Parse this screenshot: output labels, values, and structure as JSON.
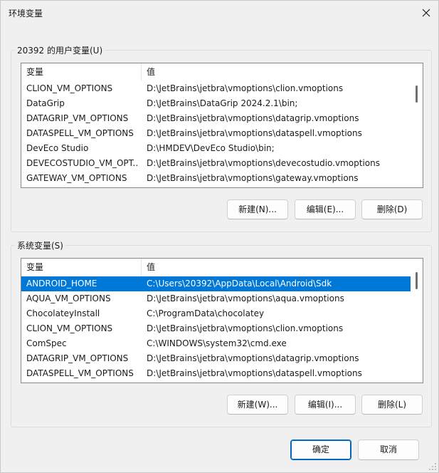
{
  "window": {
    "title": "环境变量",
    "close_icon": "close-icon"
  },
  "user_vars": {
    "group_label": "20392 的用户变量(U)",
    "columns": [
      "变量",
      "值"
    ],
    "rows": [
      {
        "name": "CLION_VM_OPTIONS",
        "value": "D:\\JetBrains\\jetbra\\vmoptions\\clion.vmoptions"
      },
      {
        "name": "DataGrip",
        "value": "D:\\JetBrains\\DataGrip 2024.2.1\\bin;"
      },
      {
        "name": "DATAGRIP_VM_OPTIONS",
        "value": "D:\\JetBrains\\jetbra\\vmoptions\\datagrip.vmoptions"
      },
      {
        "name": "DATASPELL_VM_OPTIONS",
        "value": "D:\\JetBrains\\jetbra\\vmoptions\\dataspell.vmoptions"
      },
      {
        "name": "DevEco Studio",
        "value": "D:\\HMDEV\\DevEco Studio\\bin;"
      },
      {
        "name": "DEVECOSTUDIO_VM_OPT...",
        "value": "D:\\JetBrains\\jetbra\\vmoptions\\devecostudio.vmoptions"
      },
      {
        "name": "GATEWAY_VM_OPTIONS",
        "value": "D:\\JetBrains\\jetbra\\vmoptions\\gateway.vmoptions"
      }
    ],
    "buttons": {
      "new": "新建(N)...",
      "edit": "编辑(E)...",
      "delete": "删除(D)"
    }
  },
  "system_vars": {
    "group_label": "系统变量(S)",
    "columns": [
      "变量",
      "值"
    ],
    "selected_index": 0,
    "rows": [
      {
        "name": "ANDROID_HOME",
        "value": "C:\\Users\\20392\\AppData\\Local\\Android\\Sdk"
      },
      {
        "name": "AQUA_VM_OPTIONS",
        "value": "D:\\JetBrains\\jetbra\\vmoptions\\aqua.vmoptions"
      },
      {
        "name": "ChocolateyInstall",
        "value": "C:\\ProgramData\\chocolatey"
      },
      {
        "name": "CLION_VM_OPTIONS",
        "value": "D:\\JetBrains\\jetbra\\vmoptions\\clion.vmoptions"
      },
      {
        "name": "ComSpec",
        "value": "C:\\WINDOWS\\system32\\cmd.exe"
      },
      {
        "name": "DATAGRIP_VM_OPTIONS",
        "value": "D:\\JetBrains\\jetbra\\vmoptions\\datagrip.vmoptions"
      },
      {
        "name": "DATASPELL_VM_OPTIONS",
        "value": "D:\\JetBrains\\jetbra\\vmoptions\\dataspell.vmoptions"
      }
    ],
    "buttons": {
      "new": "新建(W)...",
      "edit": "编辑(I)...",
      "delete": "删除(L)"
    }
  },
  "footer": {
    "ok": "确定",
    "cancel": "取消"
  },
  "colors": {
    "selection": "#0078d7",
    "primary_border": "#0067c0"
  }
}
